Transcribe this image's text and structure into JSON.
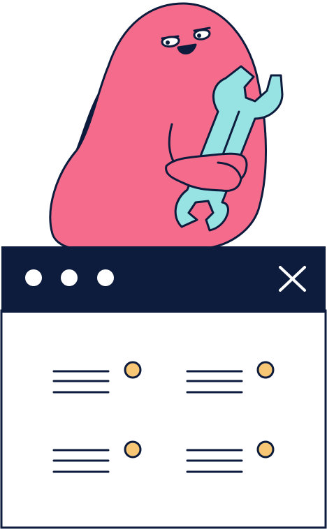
{
  "illustration": {
    "subject": "mascot-holding-wrench-on-browser-window",
    "colors": {
      "navy": "#0d1b3d",
      "pink": "#f46b8b",
      "wrench": "#97e2e2",
      "dot": "#f7c776",
      "window_bg": "#ffffff",
      "white": "#ffffff"
    },
    "icons": [
      "mascot",
      "wrench-icon",
      "close-icon",
      "window-dot",
      "text-lines-icon"
    ]
  },
  "window": {
    "title_bar_dots": 3,
    "content_items": 4
  }
}
